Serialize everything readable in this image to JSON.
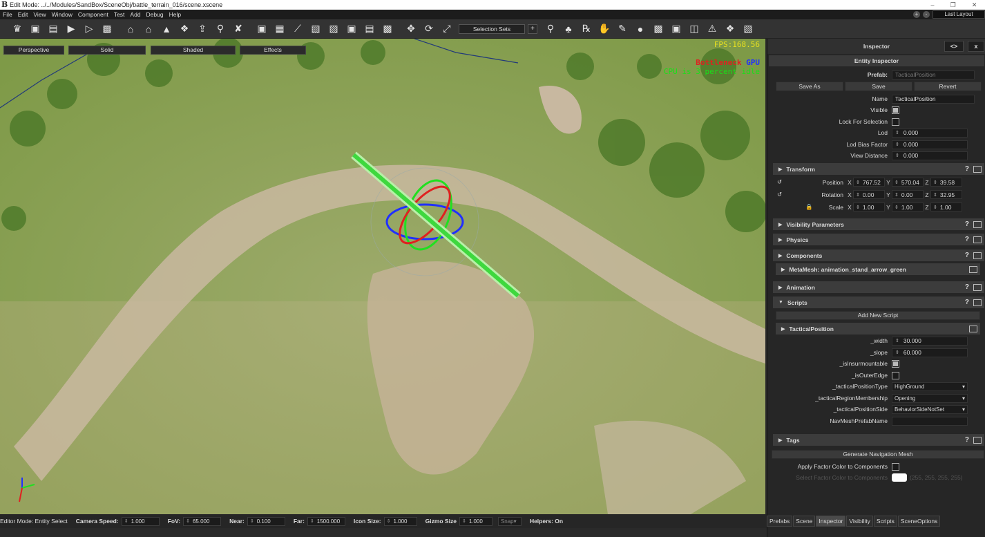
{
  "window": {
    "title": "Edit Mode: ../../Modules/SandBox/SceneObj/battle_terrain_016/scene.xscene",
    "logo": "B"
  },
  "menu": [
    "File",
    "Edit",
    "View",
    "Window",
    "Component",
    "Test",
    "Add",
    "Debug",
    "Help"
  ],
  "layout_button": "Last Layout",
  "toolbar": {
    "selection_sets": "Selection Sets"
  },
  "viewport": {
    "modes": [
      "Perspective",
      "Solid",
      "Shaded",
      "Effects"
    ],
    "fps": "FPS:168.56",
    "bottleneck_label": "Bottleneck",
    "bottleneck_value": "GPU",
    "cpu_idle": "CPU is 3 percent idle"
  },
  "statusbar": {
    "editor_mode": "Editor Mode: Entity Select",
    "camera_speed_label": "Camera Speed:",
    "camera_speed": "1.000",
    "fov_label": "FoV:",
    "fov": "65.000",
    "near_label": "Near:",
    "near": "0.100",
    "far_label": "Far:",
    "far": "1500.000",
    "icon_size_label": "Icon Size:",
    "icon_size": "1.000",
    "gizmo_size_label": "Gizmo Size",
    "gizmo_size": "1.000",
    "snap": "Snap",
    "helpers": "Helpers: On"
  },
  "inspector": {
    "title": "Inspector",
    "header_buttons": [
      "<>",
      "x"
    ],
    "entity_inspector": "Entity Inspector",
    "prefab_label": "Prefab:",
    "prefab_value": "TacticalPosition",
    "buttons": [
      "Save As",
      "Save",
      "Revert"
    ],
    "fields": {
      "name_label": "Name",
      "name_value": "TacticalPosition",
      "visible_label": "Visible",
      "lock_label": "Lock For Selection",
      "lod_label": "Lod",
      "lod_value": "0.000",
      "lod_bias_label": "Lod Bias Factor",
      "lod_bias_value": "0.000",
      "view_dist_label": "View Distance",
      "view_dist_value": "0.000"
    },
    "transform": {
      "title": "Transform",
      "position_label": "Position",
      "position": [
        "767.52",
        "570.04",
        "39.58"
      ],
      "rotation_label": "Rotation",
      "rotation": [
        "0.00",
        "0.00",
        "32.95"
      ],
      "scale_label": "Scale",
      "scale": [
        "1.00",
        "1.00",
        "1.00"
      ],
      "axes": [
        "X",
        "Y",
        "Z"
      ]
    },
    "sections": {
      "visibility": "Visibility Parameters",
      "physics": "Physics",
      "components": "Components",
      "metamesh": "MetaMesh: animation_stand_arrow_green",
      "animation": "Animation",
      "scripts": "Scripts",
      "tags": "Tags"
    },
    "add_script": "Add New Script",
    "script": {
      "name": "TacticalPosition",
      "width_label": "_width",
      "width_value": "30.000",
      "slope_label": "_slope",
      "slope_value": "60.000",
      "insurmountable_label": "_isInsurmountable",
      "outer_edge_label": "_isOuterEdge",
      "type_label": "_tacticalPositionType",
      "type_value": "HighGround",
      "region_label": "_tacticalRegionMembership",
      "region_value": "Opening",
      "side_label": "_tacticalPositionSide",
      "side_value": "BehaviorSideNotSet",
      "navmesh_label": "NavMeshPrefabName",
      "navmesh_value": ""
    },
    "generate_navmesh": "Generate Navigation Mesh",
    "apply_factor_label": "Apply Factor Color to Components",
    "select_factor_label": "Select Factor Color to Components",
    "factor_value": "(255, 255, 255, 255)"
  },
  "panel_tabs": [
    "Prefabs",
    "Scene",
    "Inspector",
    "Visibility",
    "Scripts",
    "SceneOptions"
  ],
  "active_tab": "Inspector",
  "colors": {
    "accent_red": "#e02020",
    "accent_blue": "#2030ff",
    "accent_green": "#20e020",
    "panel_bg": "#262626"
  }
}
